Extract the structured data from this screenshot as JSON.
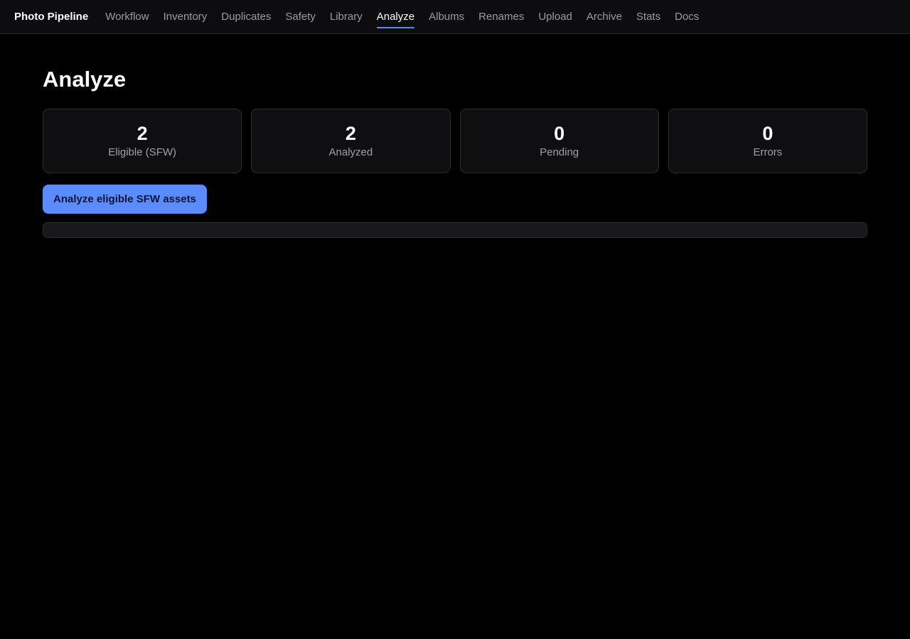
{
  "header": {
    "brand": "Photo Pipeline",
    "nav": [
      {
        "label": "Workflow",
        "active": false
      },
      {
        "label": "Inventory",
        "active": false
      },
      {
        "label": "Duplicates",
        "active": false
      },
      {
        "label": "Safety",
        "active": false
      },
      {
        "label": "Library",
        "active": false
      },
      {
        "label": "Analyze",
        "active": true
      },
      {
        "label": "Albums",
        "active": false
      },
      {
        "label": "Renames",
        "active": false
      },
      {
        "label": "Upload",
        "active": false
      },
      {
        "label": "Archive",
        "active": false
      },
      {
        "label": "Stats",
        "active": false
      },
      {
        "label": "Docs",
        "active": false
      }
    ]
  },
  "page": {
    "title": "Analyze"
  },
  "stats": [
    {
      "value": "2",
      "label": "Eligible (SFW)"
    },
    {
      "value": "2",
      "label": "Analyzed"
    },
    {
      "value": "0",
      "label": "Pending"
    },
    {
      "value": "0",
      "label": "Errors"
    }
  ],
  "actions": {
    "analyze_label": "Analyze eligible SFW assets"
  },
  "progress": {
    "fraction": 0
  },
  "colors": {
    "accent": "#5b8cff",
    "background": "#000000",
    "card": "#0f0f12"
  }
}
